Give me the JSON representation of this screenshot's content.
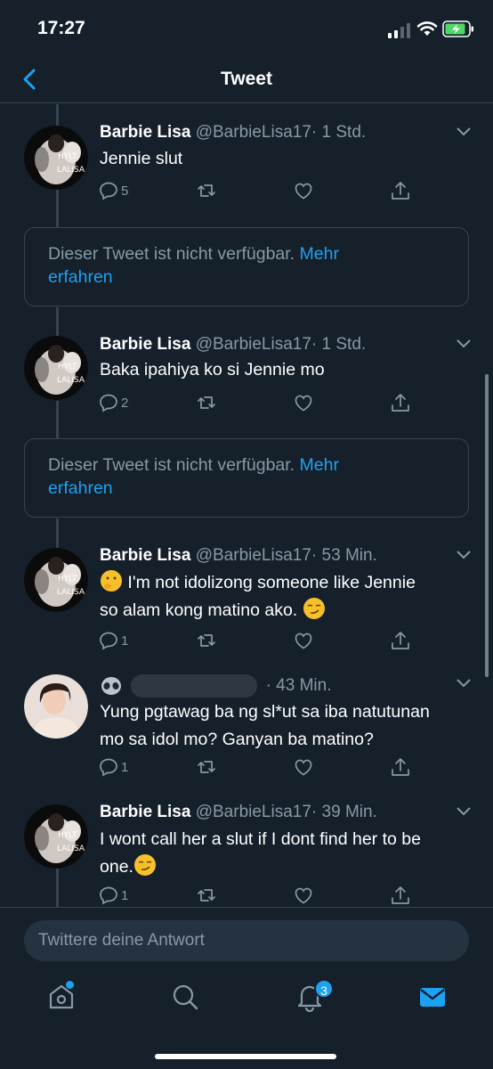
{
  "status_bar": {
    "time": "17:27"
  },
  "nav": {
    "title": "Tweet"
  },
  "tweets": [
    {
      "name": "Barbie Lisa",
      "handle": "@BarbieLisa17",
      "time": "· 1 Std.",
      "text": "Jennie slut",
      "replies": "5",
      "avatar_label_1": "HYLT",
      "avatar_label_2": "LALISA"
    },
    {
      "name": "Barbie Lisa",
      "handle": "@BarbieLisa17",
      "time": "· 1 Std.",
      "text": "Baka ipahiya ko si Jennie mo",
      "replies": "2",
      "avatar_label_1": "HYLT",
      "avatar_label_2": "LALISA"
    },
    {
      "name": "Barbie Lisa",
      "handle": "@BarbieLisa17",
      "time": "· 53 Min.",
      "text_line1": "I'm not idolizong someone like Jennie",
      "text_line2": "so alam kong matino ako.",
      "replies": "1",
      "avatar_label_1": "HYLT",
      "avatar_label_2": "LALISA"
    },
    {
      "name": "",
      "handle": "",
      "time": "· 43 Min.",
      "text_line1": "Yung pgtawag ba ng sl*ut sa iba natutunan",
      "text_line2": "mo sa idol mo? Ganyan ba matino?",
      "replies": "1"
    },
    {
      "name": "Barbie Lisa",
      "handle": "@BarbieLisa17",
      "time": "· 39 Min.",
      "text_line1": "I wont call her a slut if I dont find her to be",
      "text_line2": "one.",
      "replies": "1",
      "avatar_label_1": "HYLT",
      "avatar_label_2": "LALISA"
    }
  ],
  "unavailable": {
    "text": "Dieser Tweet ist nicht verfügbar.",
    "link_1": "Mehr",
    "link_2": "erfahren"
  },
  "reply": {
    "placeholder": "Twittere deine Antwort"
  },
  "tabbar": {
    "notifications_count": "3"
  },
  "colors": {
    "background": "#15202b",
    "accent": "#1da1f2",
    "muted": "#8899a6",
    "border": "#38444d"
  },
  "icons": [
    "back-arrow-icon",
    "reply-icon",
    "retweet-icon",
    "like-icon",
    "share-icon",
    "chevron-down-icon",
    "home-icon",
    "search-icon",
    "bell-icon",
    "mail-icon",
    "alien-emoji-icon",
    "face-emoji-icon",
    "smirk-emoji-icon"
  ]
}
